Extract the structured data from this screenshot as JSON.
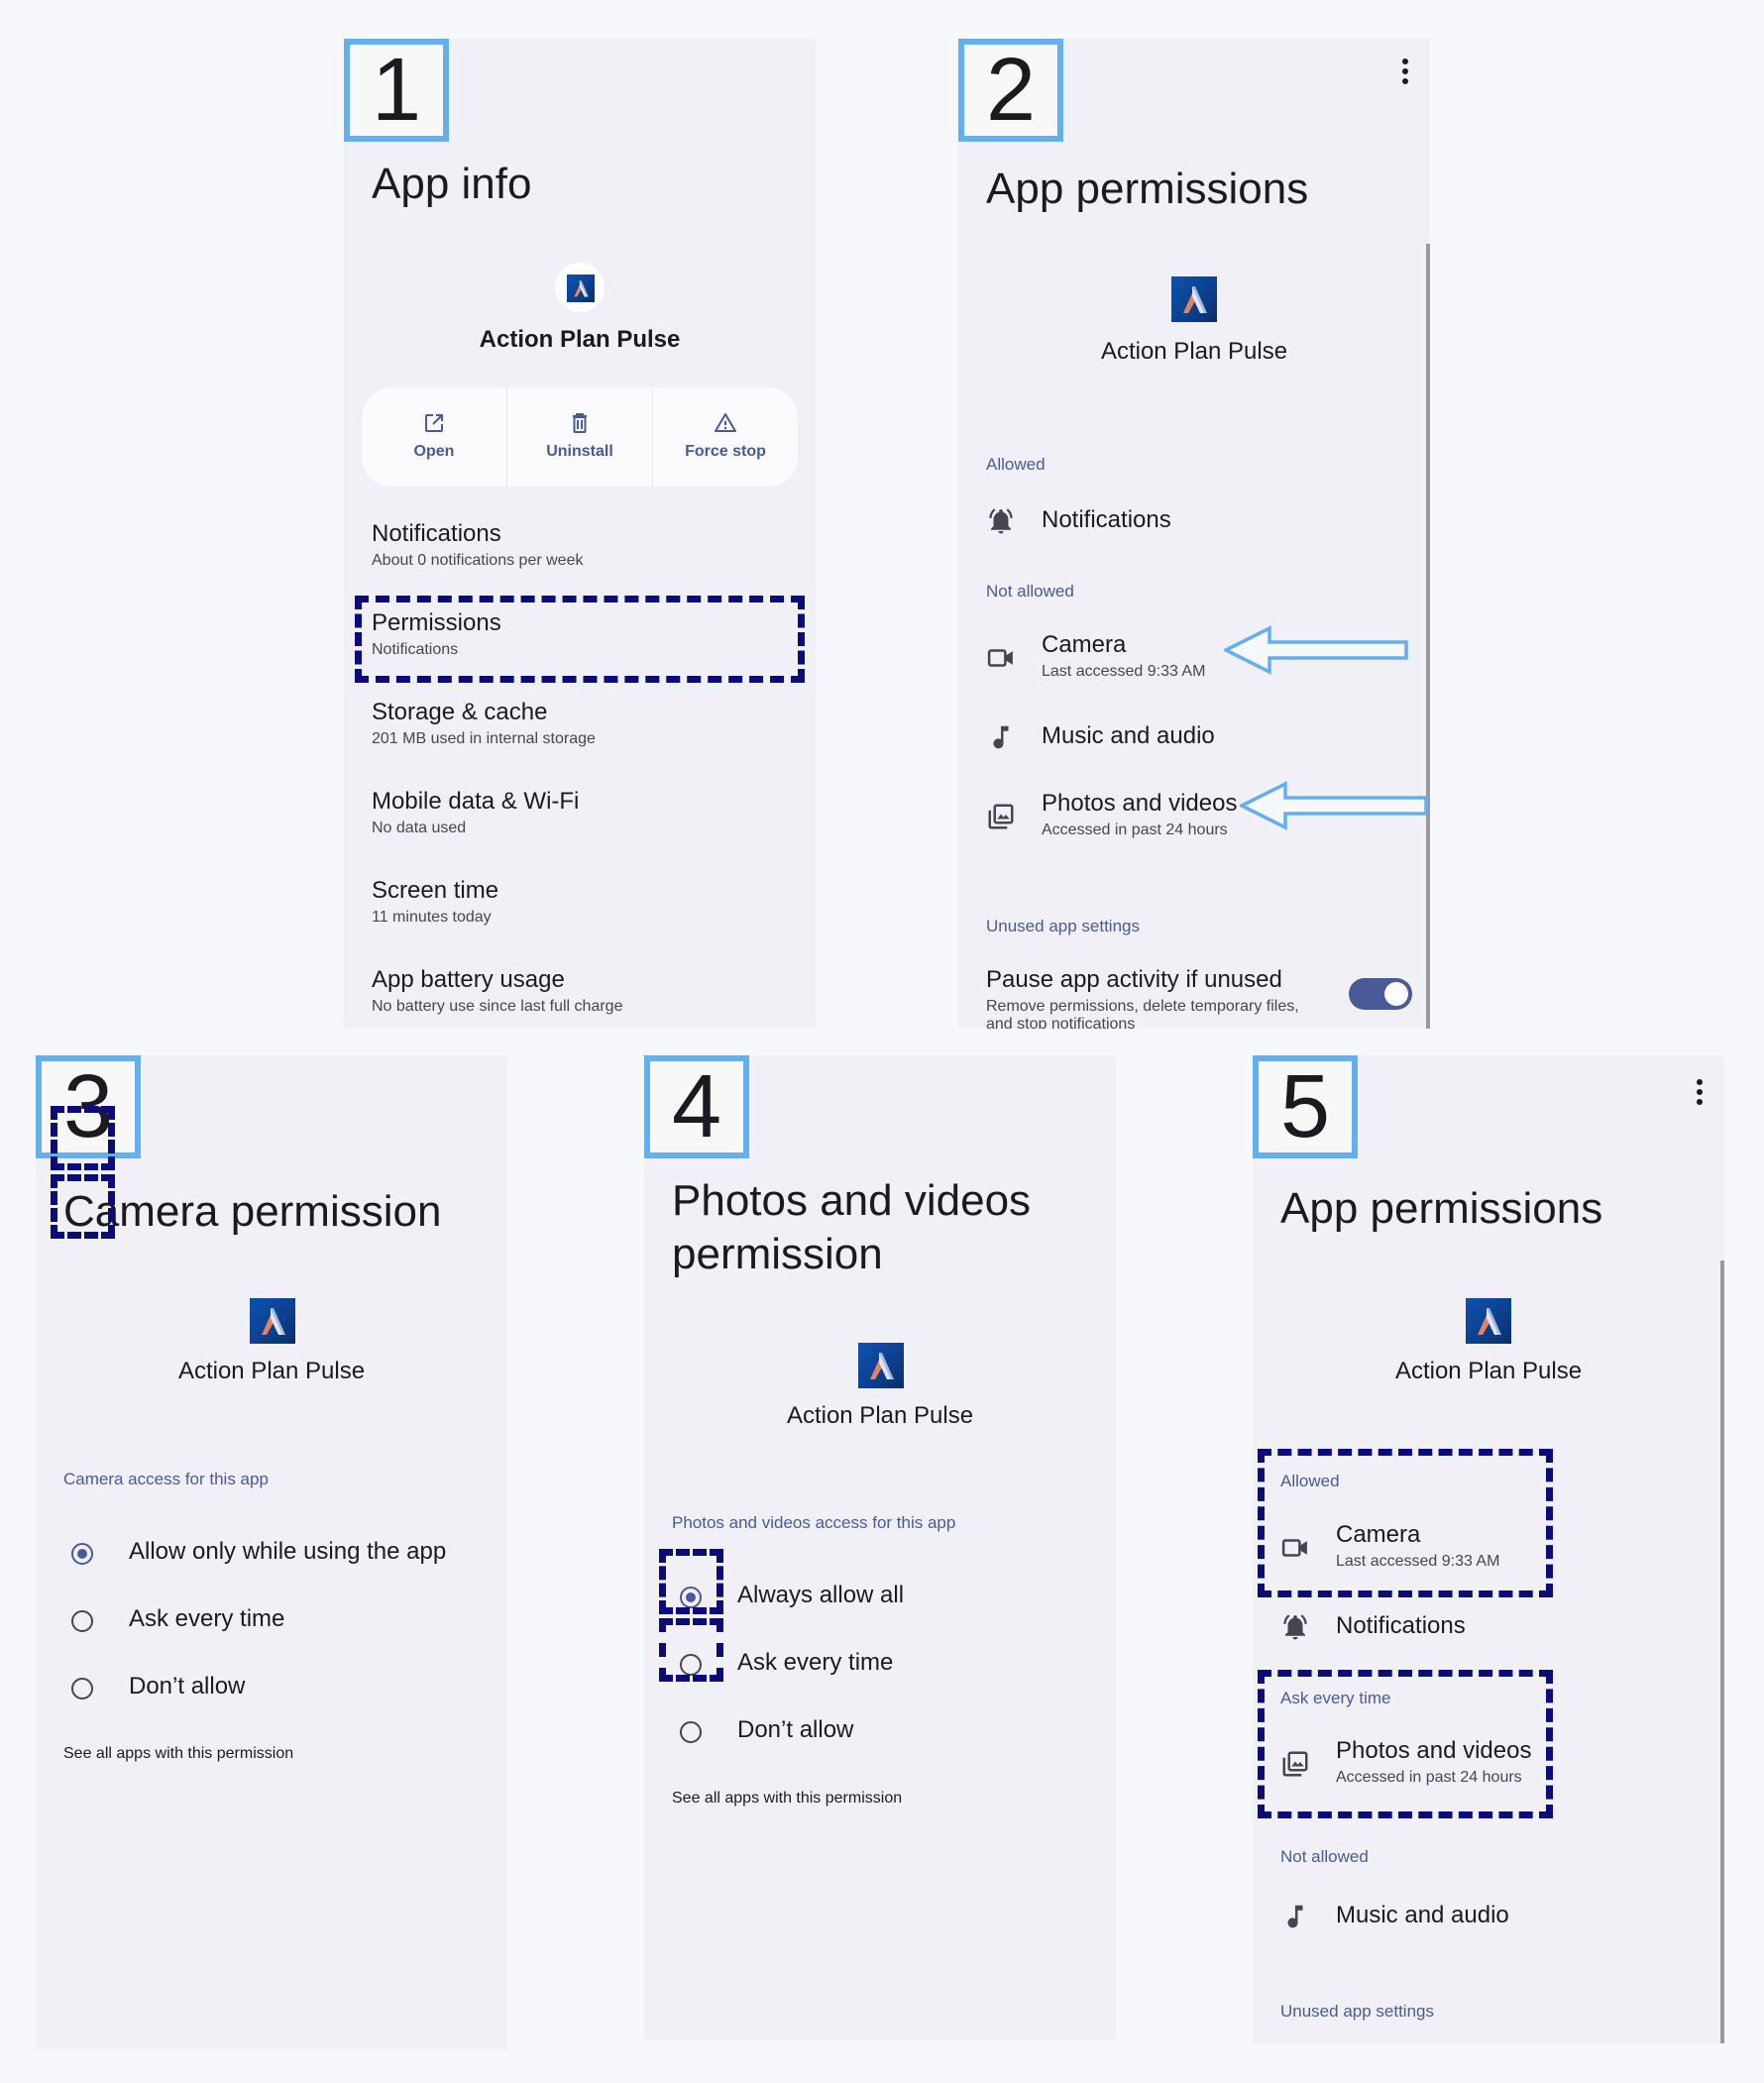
{
  "app_name": "Action Plan Pulse",
  "colors": {
    "accent": "#4a5a98",
    "badge_border": "#64b0ee",
    "highlight": "#0b0b7a",
    "panel_bg": "#f1f0f6"
  },
  "panel1": {
    "step": "1",
    "title": "App info",
    "actions": [
      {
        "label": "Open",
        "icon": "open-external-icon"
      },
      {
        "label": "Uninstall",
        "icon": "trash-icon"
      },
      {
        "label": "Force stop",
        "icon": "warning-icon"
      }
    ],
    "items": [
      {
        "title": "Notifications",
        "subtitle": "About 0 notifications per week"
      },
      {
        "title": "Permissions",
        "subtitle": "Notifications",
        "highlighted": true
      },
      {
        "title": "Storage & cache",
        "subtitle": "201 MB used in internal storage"
      },
      {
        "title": "Mobile data & Wi-Fi",
        "subtitle": "No data used"
      },
      {
        "title": "Screen time",
        "subtitle": "11 minutes today"
      },
      {
        "title": "App battery usage",
        "subtitle": "No battery use since last full charge"
      }
    ]
  },
  "panel2": {
    "step": "2",
    "title": "App permissions",
    "section_allowed": "Allowed",
    "section_not_allowed": "Not allowed",
    "section_unused": "Unused app settings",
    "notifications": {
      "title": "Notifications",
      "icon": "bell-icon"
    },
    "camera": {
      "title": "Camera",
      "subtitle": "Last accessed 9:33 AM",
      "icon": "camera-icon"
    },
    "music": {
      "title": "Music and audio",
      "icon": "music-note-icon"
    },
    "photos": {
      "title": "Photos and videos",
      "subtitle": "Accessed in past 24 hours",
      "icon": "photo-library-icon"
    },
    "pause": {
      "title": "Pause app activity if unused",
      "subtitle": "Remove permissions, delete temporary files, and stop notifications",
      "enabled": true
    }
  },
  "panel3": {
    "step": "3",
    "title": "Camera permission",
    "section": "Camera access for this app",
    "options": [
      {
        "label": "Allow only while using the app",
        "selected": true
      },
      {
        "label": "Ask every time",
        "selected": false
      },
      {
        "label": "Don’t allow",
        "selected": false
      }
    ],
    "see_all": "See all apps with this permission"
  },
  "panel4": {
    "step": "4",
    "title_line1": "Photos and videos",
    "title_line2": "permission",
    "section": "Photos and videos access for this app",
    "options": [
      {
        "label": "Always allow all",
        "selected": true
      },
      {
        "label": "Ask every time",
        "selected": false
      },
      {
        "label": "Don’t allow",
        "selected": false
      }
    ],
    "see_all": "See all apps with this permission"
  },
  "panel5": {
    "step": "5",
    "title": "App permissions",
    "section_allowed": "Allowed",
    "section_ask": "Ask every time",
    "section_not_allowed": "Not allowed",
    "section_unused": "Unused app settings",
    "camera": {
      "title": "Camera",
      "subtitle": "Last accessed 9:33 AM"
    },
    "notifications": {
      "title": "Notifications"
    },
    "photos": {
      "title": "Photos and videos",
      "subtitle": "Accessed in past 24 hours"
    },
    "music": {
      "title": "Music and audio"
    }
  }
}
